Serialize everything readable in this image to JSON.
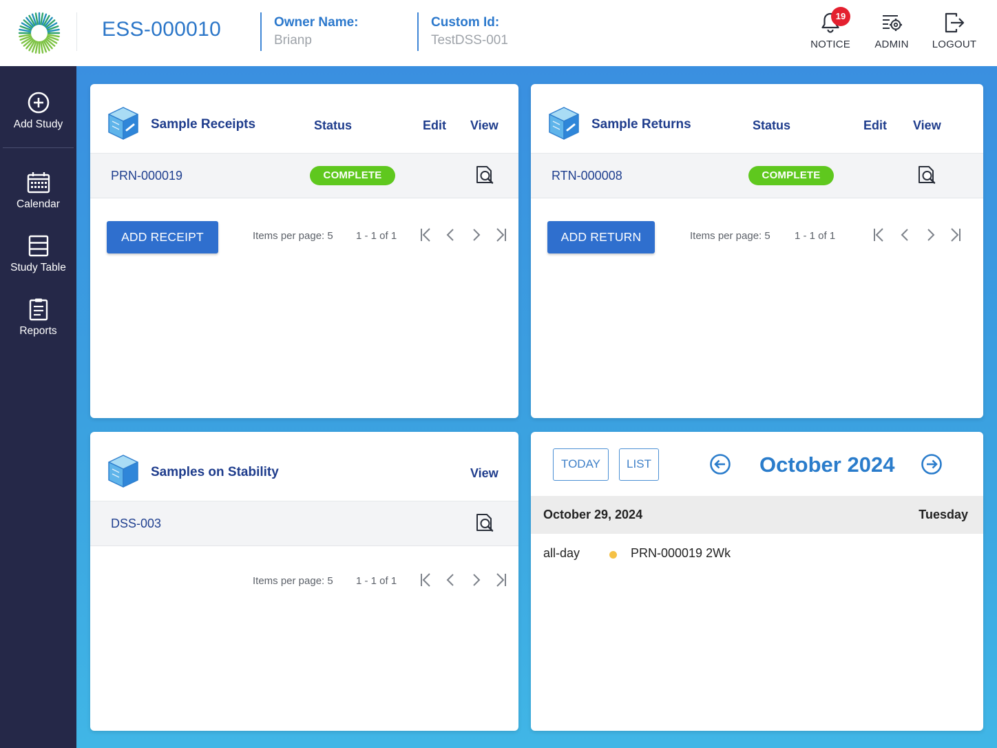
{
  "header": {
    "study_id": "ESS-000010",
    "owner_label": "Owner Name:",
    "owner_value": "Brianp",
    "custom_label": "Custom Id:",
    "custom_value": "TestDSS-001",
    "notice_label": "NOTICE",
    "notice_count": "19",
    "admin_label": "ADMIN",
    "logout_label": "LOGOUT"
  },
  "sidebar": {
    "items": [
      {
        "label": "Add Study",
        "icon": "plus-circle-icon"
      },
      {
        "label": "Calendar",
        "icon": "calendar-icon"
      },
      {
        "label": "Study Table",
        "icon": "table-icon"
      },
      {
        "label": "Reports",
        "icon": "report-icon"
      }
    ]
  },
  "receipts": {
    "title": "Sample Receipts",
    "col_status": "Status",
    "col_edit": "Edit",
    "col_view": "View",
    "rows": [
      {
        "id": "PRN-000019",
        "status": "COMPLETE"
      }
    ],
    "add_button": "ADD RECEIPT",
    "items_per_page": "Items per page: 5",
    "range": "1 - 1 of 1"
  },
  "returns": {
    "title": "Sample Returns",
    "col_status": "Status",
    "col_edit": "Edit",
    "col_view": "View",
    "rows": [
      {
        "id": "RTN-000008",
        "status": "COMPLETE"
      }
    ],
    "add_button": "ADD RETURN",
    "items_per_page": "Items per page: 5",
    "range": "1 - 1 of 1"
  },
  "stability": {
    "title": "Samples on Stability",
    "col_view": "View",
    "rows": [
      {
        "id": "DSS-003"
      }
    ],
    "items_per_page": "Items per page: 5",
    "range": "1 - 1 of 1"
  },
  "calendar": {
    "today_button": "TODAY",
    "list_button": "LIST",
    "month": "October 2024",
    "day_date": "October 29, 2024",
    "day_weekday": "Tuesday",
    "events": [
      {
        "time": "all-day",
        "title": "PRN-000019 2Wk",
        "dot_color": "#f5c145"
      }
    ]
  },
  "colors": {
    "accent": "#2b76c8",
    "nav_bg": "#252848",
    "complete": "#5fc81e",
    "button": "#2f6fce"
  }
}
